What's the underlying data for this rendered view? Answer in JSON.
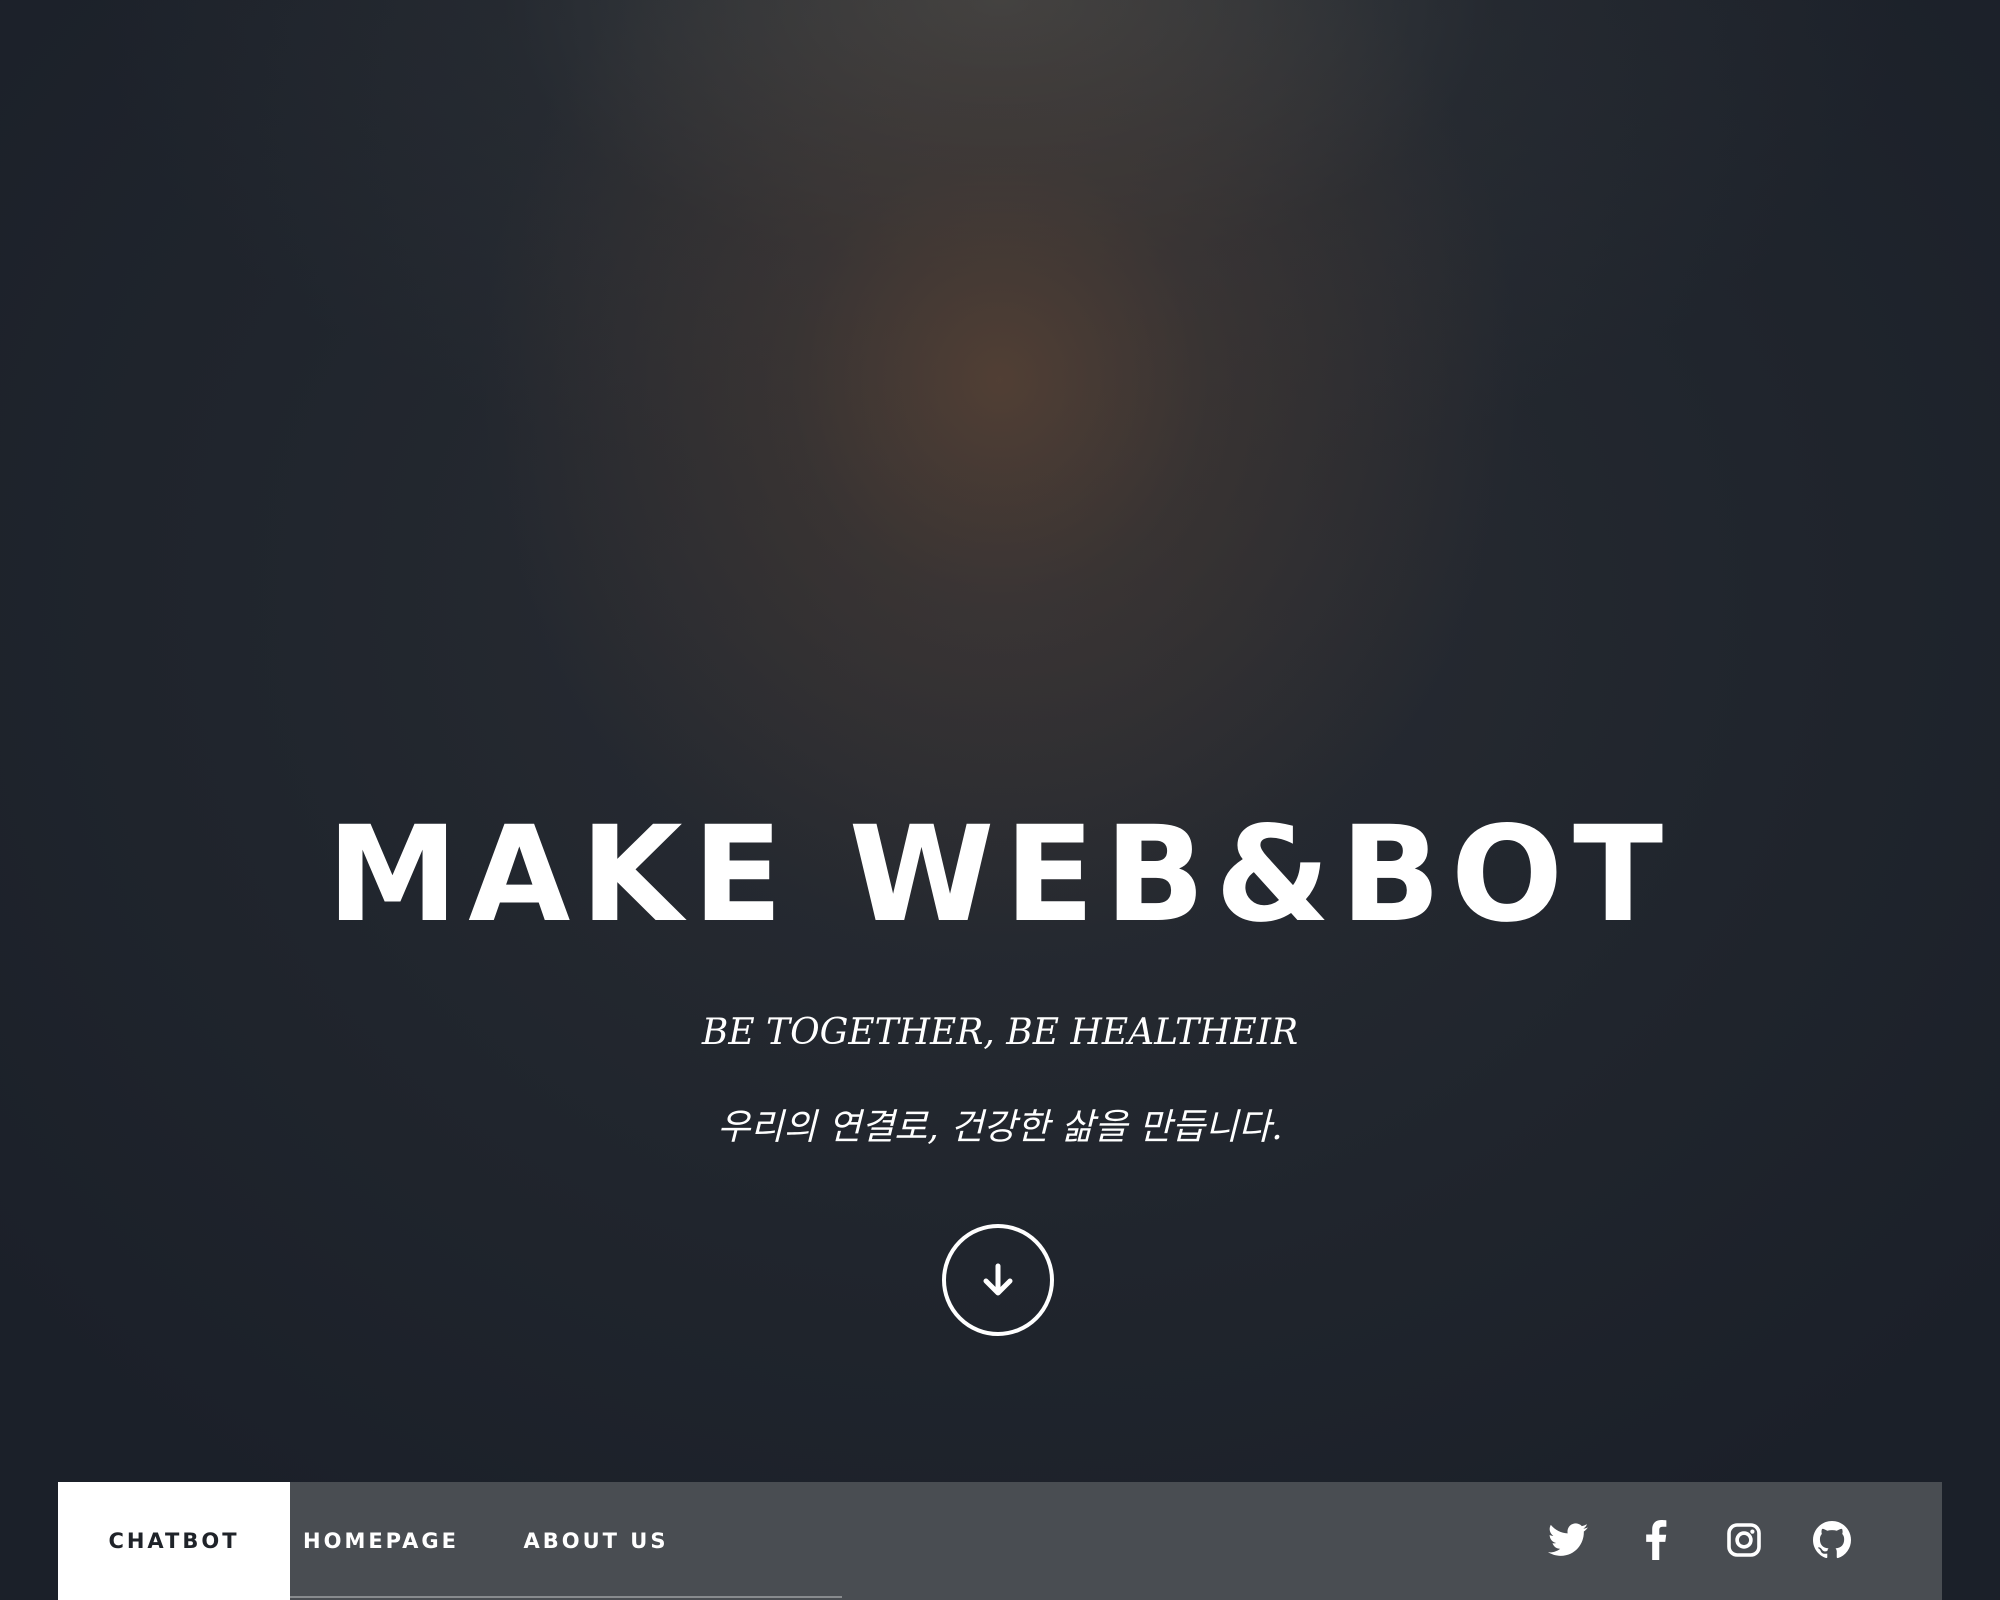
{
  "hero": {
    "title": "MAKE WEB&BOT",
    "subtitle_en": "BE TOGETHER, BE HEALTHEIR",
    "subtitle_ko": "우리의 연결로, 건강한 삶을 만듭니다.",
    "scroll_icon": "arrow-down-icon"
  },
  "nav": {
    "tabs": [
      {
        "label": "CHATBOT",
        "active": true
      },
      {
        "label": "HOMEPAGE",
        "active": false
      },
      {
        "label": "ABOUT US",
        "active": false
      }
    ],
    "social_icons": [
      "twitter-icon",
      "facebook-icon",
      "instagram-icon",
      "github-icon"
    ]
  },
  "colors": {
    "background": "#1c2129",
    "navbar": "#494d52",
    "active_tab": "#ffffff",
    "text": "#ffffff"
  }
}
